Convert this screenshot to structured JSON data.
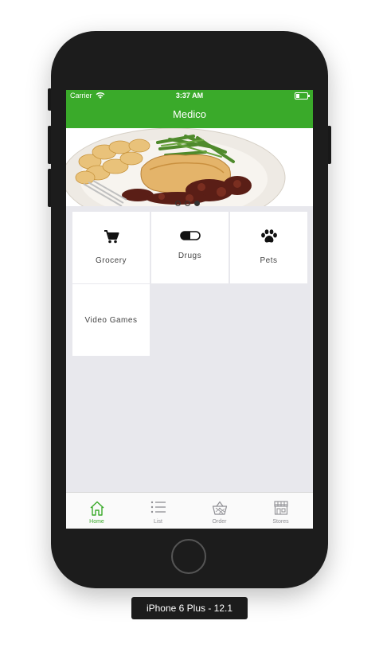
{
  "status_bar": {
    "carrier": "Carrier",
    "time": "3:37 AM",
    "icons": [
      "wifi-icon",
      "battery-icon"
    ]
  },
  "nav": {
    "title": "Medico"
  },
  "banner": {
    "pager_count": 3,
    "pager_active": 2
  },
  "categories": [
    {
      "label": "Grocery",
      "icon": "cart-icon"
    },
    {
      "label": "Drugs",
      "icon": "pill-icon"
    },
    {
      "label": "Pets",
      "icon": "paw-icon"
    },
    {
      "label": "Video Games",
      "icon": ""
    }
  ],
  "tabbar": {
    "items": [
      {
        "label": "Home",
        "icon": "home-icon",
        "active": true
      },
      {
        "label": "List",
        "icon": "list-icon",
        "active": false
      },
      {
        "label": "Order",
        "icon": "basket-icon",
        "active": false
      },
      {
        "label": "Stores",
        "icon": "store-icon",
        "active": false
      }
    ]
  },
  "device": {
    "label": "iPhone 6 Plus - 12.1"
  },
  "colors": {
    "accent": "#3aaa2a",
    "screen_bg": "#e8e8ed",
    "device_body": "#1c1c1c"
  }
}
